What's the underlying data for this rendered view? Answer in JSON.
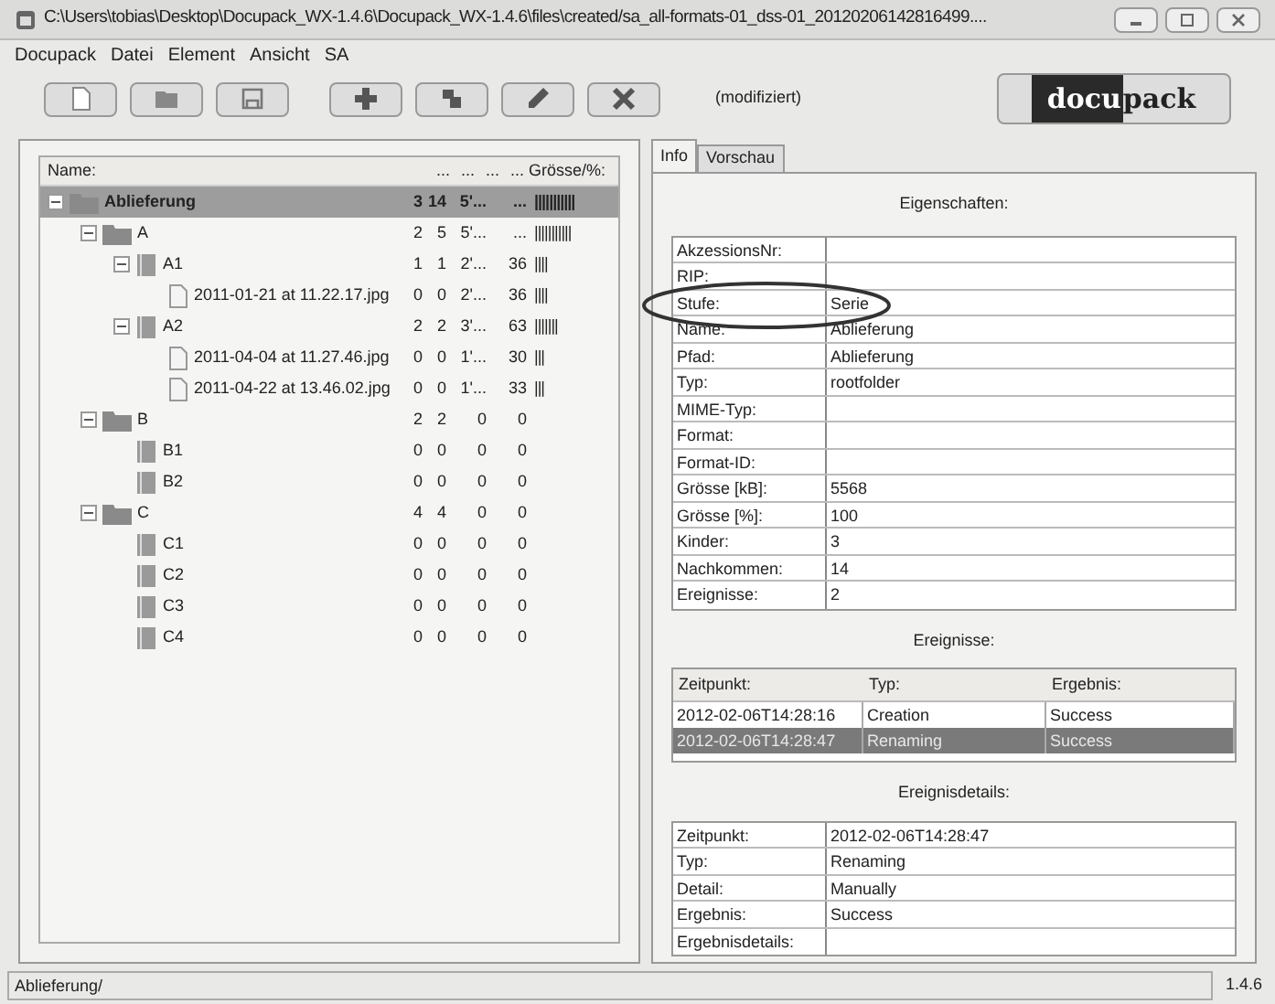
{
  "window": {
    "title": "C:\\Users\\tobias\\Desktop\\Docupack_WX-1.4.6\\Docupack_WX-1.4.6\\files\\created/sa_all-formats-01_dss-01_20120206142816499...."
  },
  "menu": [
    "Docupack",
    "Datei",
    "Element",
    "Ansicht",
    "SA"
  ],
  "toolbar": {
    "status": "(modifiziert)",
    "logo": [
      "docu",
      "pack"
    ]
  },
  "tree": {
    "columns": [
      "Name:",
      "...",
      "...",
      "...",
      "... Grösse/%:"
    ],
    "items": [
      {
        "name": "Ablieferung",
        "kind": "folder",
        "expanded": true,
        "selected": true,
        "cells": [
          "3",
          "14",
          "5'...",
          "...",
          "|||||||||||"
        ],
        "children": [
          {
            "name": "A",
            "kind": "folder",
            "expanded": true,
            "selected": false,
            "cells": [
              "2",
              "5",
              "5'...",
              "...",
              "|||||||||||"
            ],
            "children": [
              {
                "name": "A1",
                "kind": "container",
                "expanded": true,
                "selected": false,
                "cells": [
                  "1",
                  "1",
                  "2'...",
                  "36",
                  "||||"
                ],
                "children": [
                  {
                    "name": "2011-01-21 at 11.22.17.jpg",
                    "kind": "file",
                    "selected": false,
                    "cells": [
                      "0",
                      "0",
                      "2'...",
                      "36",
                      "||||"
                    ]
                  }
                ]
              },
              {
                "name": "A2",
                "kind": "container",
                "expanded": true,
                "selected": false,
                "cells": [
                  "2",
                  "2",
                  "3'...",
                  "63",
                  "|||||||"
                ],
                "children": [
                  {
                    "name": "2011-04-04 at 11.27.46.jpg",
                    "kind": "file",
                    "selected": false,
                    "cells": [
                      "0",
                      "0",
                      "1'...",
                      "30",
                      "|||"
                    ]
                  },
                  {
                    "name": "2011-04-22 at 13.46.02.jpg",
                    "kind": "file",
                    "selected": false,
                    "cells": [
                      "0",
                      "0",
                      "1'...",
                      "33",
                      "|||"
                    ]
                  }
                ]
              }
            ]
          },
          {
            "name": "B",
            "kind": "folder",
            "expanded": true,
            "selected": false,
            "cells": [
              "2",
              "2",
              "0",
              "0"
            ],
            "children": [
              {
                "name": "B1",
                "kind": "container",
                "selected": false,
                "cells": [
                  "0",
                  "0",
                  "0",
                  "0"
                ]
              },
              {
                "name": "B2",
                "kind": "container",
                "selected": false,
                "cells": [
                  "0",
                  "0",
                  "0",
                  "0"
                ]
              }
            ]
          },
          {
            "name": "C",
            "kind": "folder",
            "expanded": true,
            "selected": false,
            "cells": [
              "4",
              "4",
              "0",
              "0"
            ],
            "children": [
              {
                "name": "C1",
                "kind": "container",
                "selected": false,
                "cells": [
                  "0",
                  "0",
                  "0",
                  "0"
                ]
              },
              {
                "name": "C2",
                "kind": "container",
                "selected": false,
                "cells": [
                  "0",
                  "0",
                  "0",
                  "0"
                ]
              },
              {
                "name": "C3",
                "kind": "container",
                "selected": false,
                "cells": [
                  "0",
                  "0",
                  "0",
                  "0"
                ]
              },
              {
                "name": "C4",
                "kind": "container",
                "selected": false,
                "cells": [
                  "0",
                  "0",
                  "0",
                  "0"
                ]
              }
            ]
          }
        ]
      }
    ]
  },
  "tabs": [
    {
      "label": "Info",
      "selected": true
    },
    {
      "label": "Vorschau",
      "selected": false
    }
  ],
  "properties": {
    "title": "Eigenschaften:",
    "rows": [
      [
        "AkzessionsNr:",
        ""
      ],
      [
        "RIP:",
        ""
      ],
      [
        "Stufe:",
        "Serie"
      ],
      [
        "Name:",
        "Ablieferung"
      ],
      [
        "Pfad:",
        "Ablieferung"
      ],
      [
        "Typ:",
        "rootfolder"
      ],
      [
        "MIME-Typ:",
        ""
      ],
      [
        "Format:",
        ""
      ],
      [
        "Format-ID:",
        ""
      ],
      [
        "Grösse [kB]:",
        "5568"
      ],
      [
        "Grösse [%]:",
        "100"
      ],
      [
        "Kinder:",
        "3"
      ],
      [
        "Nachkommen:",
        "14"
      ],
      [
        "Ereignisse:",
        "2"
      ]
    ]
  },
  "events": {
    "title": "Ereignisse:",
    "columns": [
      "Zeitpunkt:",
      "Typ:",
      "Ergebnis:"
    ],
    "rows": [
      {
        "cells": [
          "2012-02-06T14:28:16",
          "Creation",
          "Success"
        ],
        "selected": false
      },
      {
        "cells": [
          "2012-02-06T14:28:47",
          "Renaming",
          "Success"
        ],
        "selected": true
      }
    ]
  },
  "event_details": {
    "title": "Ereignisdetails:",
    "rows": [
      [
        "Zeitpunkt:",
        "2012-02-06T14:28:47"
      ],
      [
        "Typ:",
        "Renaming"
      ],
      [
        "Detail:",
        "Manually"
      ],
      [
        "Ergebnis:",
        "Success"
      ],
      [
        "Ergebnisdetails:",
        ""
      ]
    ]
  },
  "status_bar": {
    "path": "Ablieferung/",
    "version": "1.4.6"
  }
}
